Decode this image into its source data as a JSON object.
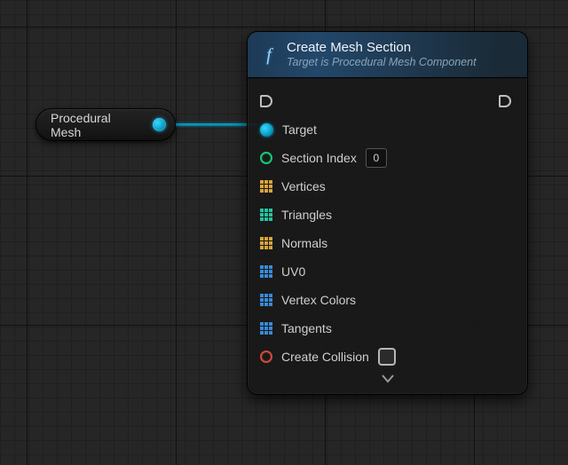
{
  "source_node": {
    "label": "Procedural Mesh"
  },
  "node": {
    "title": "Create Mesh Section",
    "subtitle": "Target is Procedural Mesh Component",
    "pins": {
      "target": "Target",
      "section_index": {
        "label": "Section Index",
        "value": "0"
      },
      "vertices": "Vertices",
      "triangles": "Triangles",
      "normals": "Normals",
      "uv0": "UV0",
      "vertex_colors": "Vertex Colors",
      "tangents": "Tangents",
      "create_collision": "Create Collision"
    }
  }
}
